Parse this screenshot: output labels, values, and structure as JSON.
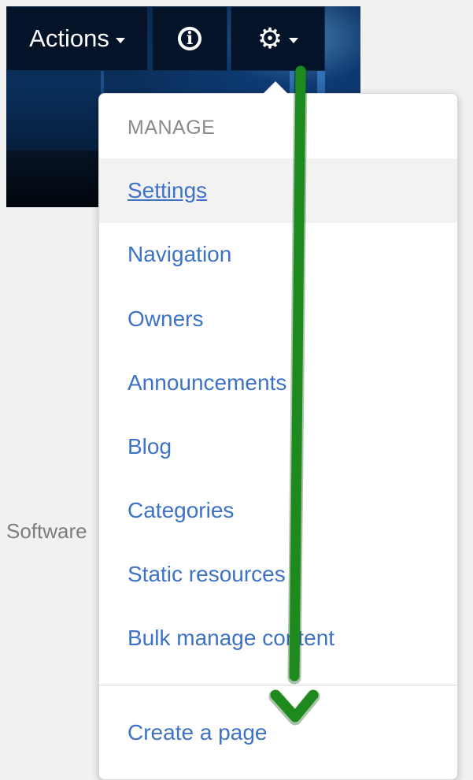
{
  "toolbar": {
    "actions_label": "Actions",
    "info_icon": "info-circle-icon",
    "gear_icon": "gear-icon"
  },
  "side_text": "Software",
  "menu": {
    "heading": "MANAGE",
    "items": [
      {
        "label": "Settings"
      },
      {
        "label": "Navigation"
      },
      {
        "label": "Owners"
      },
      {
        "label": "Announcements"
      },
      {
        "label": "Blog"
      },
      {
        "label": "Categories"
      },
      {
        "label": "Static resources"
      },
      {
        "label": "Bulk manage content"
      },
      {
        "label": "Create a page"
      }
    ]
  },
  "colors": {
    "link": "#3e72c6",
    "annotation_arrow": "#1e8a1e",
    "header_dark": "#041328"
  }
}
